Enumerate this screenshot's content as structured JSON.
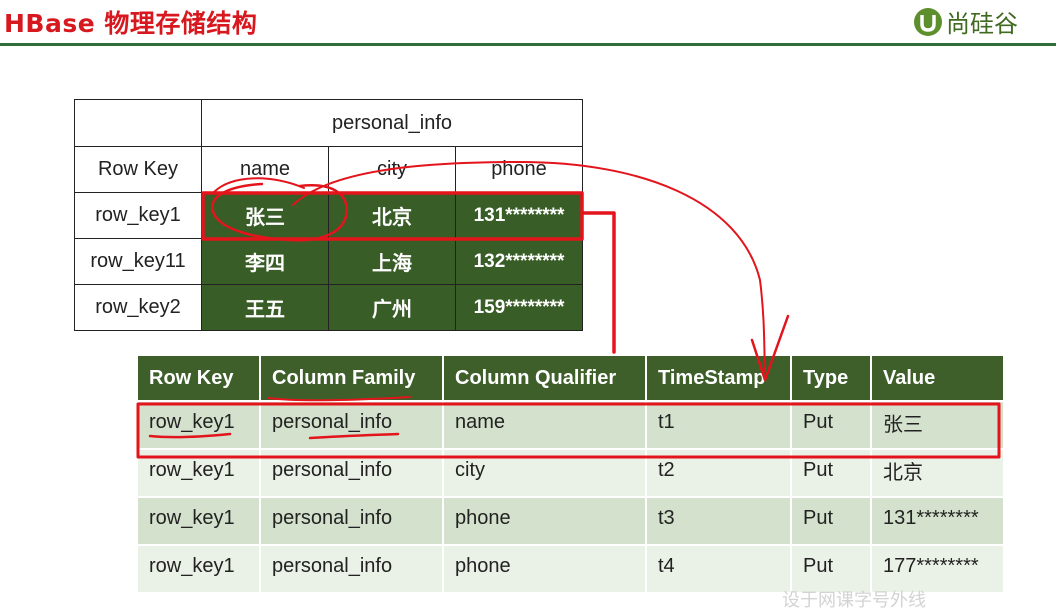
{
  "header": {
    "title": "HBase 物理存储结构",
    "brand": "尚硅谷"
  },
  "logical_table": {
    "family": "personal_info",
    "rowkey_header": "Row Key",
    "columns": [
      "name",
      "city",
      "phone"
    ],
    "rows": [
      {
        "key": "row_key1",
        "cells": [
          "张三",
          "北京",
          "131********"
        ]
      },
      {
        "key": "row_key11",
        "cells": [
          "李四",
          "上海",
          "132********"
        ]
      },
      {
        "key": "row_key2",
        "cells": [
          "王五",
          "广州",
          "159********"
        ]
      }
    ]
  },
  "physical_table": {
    "headers": [
      "Row Key",
      "Column Family",
      "Column Qualifier",
      "TimeStamp",
      "Type",
      "Value"
    ],
    "rows": [
      [
        "row_key1",
        "personal_info",
        "name",
        "t1",
        "Put",
        "张三"
      ],
      [
        "row_key1",
        "personal_info",
        "city",
        "t2",
        "Put",
        "北京"
      ],
      [
        "row_key1",
        "personal_info",
        "phone",
        "t3",
        "Put",
        "131********"
      ],
      [
        "row_key1",
        "personal_info",
        "phone",
        "t4",
        "Put",
        "177********"
      ]
    ]
  },
  "colors": {
    "title": "#d7191f",
    "dark_green": "#385d26",
    "annotation": "#e3141b"
  },
  "watermark": "设于网课字号外线"
}
